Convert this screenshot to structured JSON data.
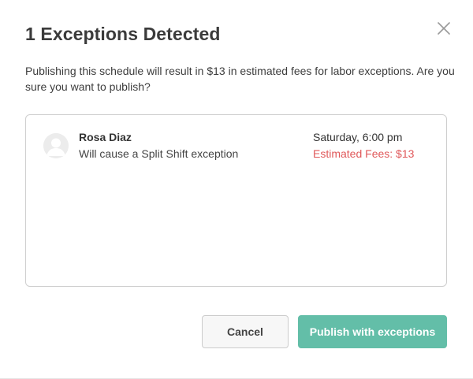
{
  "dialog": {
    "title": "1 Exceptions Detected",
    "close_icon": "close-x-icon",
    "message": "Publishing this schedule will result in $13 in estimated fees for labor exceptions. Are you sure you want to publish?"
  },
  "exceptions": [
    {
      "avatar_icon": "user-avatar-icon",
      "employee_name": "Rosa Diaz",
      "description": "Will cause a Split Shift exception",
      "shift_time": "Saturday, 6:00 pm",
      "estimated_fees": "Estimated Fees: $13"
    }
  ],
  "actions": {
    "cancel_label": "Cancel",
    "publish_label": "Publish with exceptions"
  },
  "colors": {
    "primary_button": "#63bea8",
    "fee_warning": "#e0585a",
    "title_text": "#3b3b3b",
    "box_border": "#cfcfcf"
  }
}
